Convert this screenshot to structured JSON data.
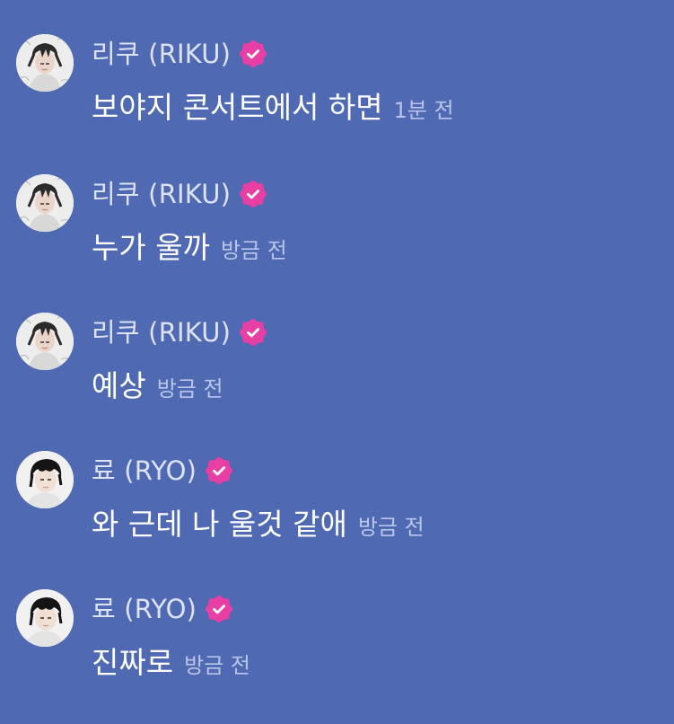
{
  "theme": {
    "background": "#5069b3",
    "name_color": "#dde3f5",
    "message_color": "#ffffff",
    "time_color": "#b9c4e8",
    "verified_badge_color": "#e83fa4"
  },
  "messages": [
    {
      "sender": "리쿠 (RIKU)",
      "verified": true,
      "avatar": "riku-avatar",
      "text": "보야지 콘서트에서 하면",
      "time": "1분 전"
    },
    {
      "sender": "리쿠 (RIKU)",
      "verified": true,
      "avatar": "riku-avatar",
      "text": "누가 울까",
      "time": "방금 전"
    },
    {
      "sender": "리쿠 (RIKU)",
      "verified": true,
      "avatar": "riku-avatar",
      "text": "예상",
      "time": "방금 전"
    },
    {
      "sender": "료 (RYO)",
      "verified": true,
      "avatar": "ryo-avatar",
      "text": "와 근데 나 울것 같애",
      "time": "방금 전"
    },
    {
      "sender": "료 (RYO)",
      "verified": true,
      "avatar": "ryo-avatar",
      "text": "진짜로",
      "time": "방금 전"
    }
  ]
}
